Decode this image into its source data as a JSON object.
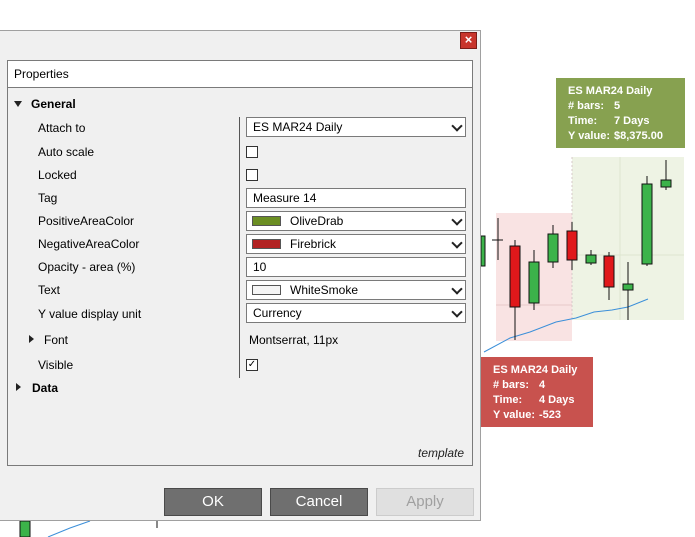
{
  "dialog": {
    "close_icon": "close-icon",
    "panel_title": "Properties",
    "categories": {
      "general": "General",
      "data": "Data"
    },
    "properties": [
      {
        "label": "Attach to"
      },
      {
        "label": "Auto scale"
      },
      {
        "label": "Locked"
      },
      {
        "label": "Tag"
      },
      {
        "label": "PositiveAreaColor"
      },
      {
        "label": "NegativeAreaColor"
      },
      {
        "label": "Opacity - area (%)"
      },
      {
        "label": "Text"
      },
      {
        "label": "Y value display unit"
      },
      {
        "label": "Font"
      },
      {
        "label": "Visible"
      }
    ],
    "values": {
      "attach_to": "ES MAR24 Daily",
      "auto_scale": false,
      "locked": false,
      "tag": "Measure 14",
      "positive_color_name": "OliveDrab",
      "positive_color": "#6b8e23",
      "negative_color_name": "Firebrick",
      "negative_color": "#b22222",
      "opacity": "10",
      "text_color_name": "WhiteSmoke",
      "text_color": "#f5f5f5",
      "y_display_unit": "Currency",
      "font": "Montserrat, 11px",
      "visible_check": "✓"
    },
    "template_label": "template",
    "buttons": {
      "ok": "OK",
      "cancel": "Cancel",
      "apply": "Apply"
    }
  },
  "chart": {
    "green_box": {
      "title": "ES MAR24 Daily",
      "rows": [
        {
          "k": "# bars:",
          "v": "5"
        },
        {
          "k": "Time:",
          "v": "7 Days"
        },
        {
          "k": "Y value:",
          "v": "$8,375.00"
        }
      ],
      "color": "#87a150"
    },
    "red_box": {
      "title": "ES MAR24 Daily",
      "rows": [
        {
          "k": "# bars:",
          "v": "4"
        },
        {
          "k": "Time:",
          "v": "4 Days"
        },
        {
          "k": "Y value:",
          "v": "-523"
        }
      ],
      "color": "#c8524e"
    },
    "colors": {
      "up": "#3cb34a",
      "down": "#e0181b",
      "line": "#3b8fd9",
      "green_area": "#eef3e4",
      "red_area": "#f9e3e3"
    }
  }
}
